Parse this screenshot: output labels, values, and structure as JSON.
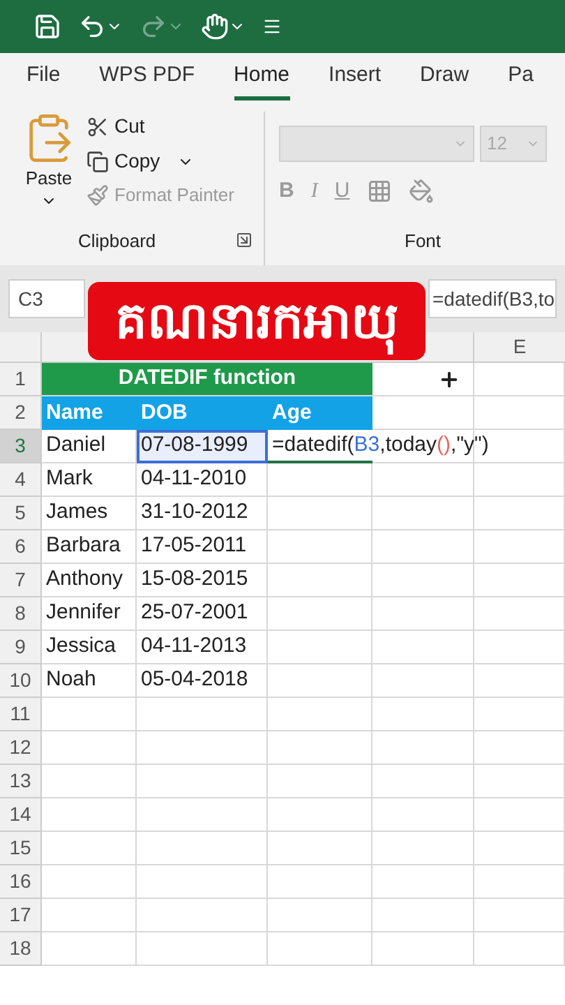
{
  "ribbon_tabs": [
    {
      "label": "File",
      "selected": false
    },
    {
      "label": "WPS PDF",
      "selected": false
    },
    {
      "label": "Home",
      "selected": true
    },
    {
      "label": "Insert",
      "selected": false
    },
    {
      "label": "Draw",
      "selected": false
    },
    {
      "label": "Pa",
      "selected": false
    }
  ],
  "clipboard": {
    "paste": "Paste",
    "cut": "Cut",
    "copy": "Copy",
    "format_painter": {
      "label": "Format Painter",
      "disabled": true
    },
    "group_label": "Clipboard"
  },
  "font": {
    "size": "12",
    "bold": "B",
    "italic": "I",
    "underline": "U",
    "group_label": "Font"
  },
  "formula_bar": {
    "name_box": "C3",
    "formula": "=datedif(B3,to"
  },
  "banner": "គណនារកអាយុ",
  "sheet": {
    "column_5": "E",
    "title_row": "1",
    "title": "DATEDIF function",
    "header_row": "2",
    "headers": [
      "Name",
      "DOB",
      "Age"
    ],
    "rows": [
      {
        "number": "3",
        "name": "Daniel",
        "dob": "07-08-1999",
        "selected": true,
        "formula": [
          {
            "text": "=datedif(",
            "color": "#222222"
          },
          {
            "text": "B3",
            "color": "#3b6fd8"
          },
          {
            "text": ",today",
            "color": "#222222"
          },
          {
            "text": "()",
            "color": "#e0655a"
          },
          {
            "text": ",\"y\")",
            "color": "#222222"
          }
        ]
      },
      {
        "number": "4",
        "name": "Mark",
        "dob": "04-11-2010",
        "selected": false
      },
      {
        "number": "5",
        "name": "James",
        "dob": "31-10-2012",
        "selected": false
      },
      {
        "number": "6",
        "name": "Barbara",
        "dob": "17-05-2011",
        "selected": false
      },
      {
        "number": "7",
        "name": "Anthony",
        "dob": "15-08-2015",
        "selected": false
      },
      {
        "number": "8",
        "name": "Jennifer",
        "dob": "25-07-2001",
        "selected": false
      },
      {
        "number": "9",
        "name": "Jessica",
        "dob": "04-11-2013",
        "selected": false
      },
      {
        "number": "10",
        "name": "Noah",
        "dob": "05-04-2018",
        "selected": false
      }
    ],
    "empty_rows": [
      "11",
      "12",
      "13",
      "14",
      "15",
      "16",
      "17",
      "18"
    ]
  }
}
